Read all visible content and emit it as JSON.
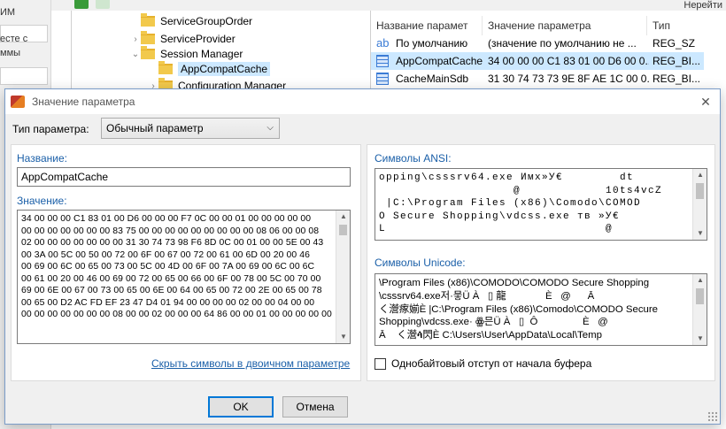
{
  "background": {
    "left_fragments": [
      "ИМ",
      "есте с",
      "ммы"
    ],
    "toolbar_edge_text": "Нерейти",
    "tree": {
      "items": [
        {
          "label": "ServiceGroupOrder",
          "expanded": false,
          "selected": false
        },
        {
          "label": "ServiceProvider",
          "expanded": false,
          "selected": false
        },
        {
          "label": "Session Manager",
          "expanded": true,
          "selected": false
        },
        {
          "label": "AppCompatCache",
          "expanded": false,
          "selected": true
        },
        {
          "label": "Configuration Manager",
          "expanded": false,
          "selected": false
        }
      ]
    },
    "list": {
      "headers": [
        "Название парамет",
        "Значение параметра",
        "Тип"
      ],
      "rows": [
        {
          "icon": "string-value-icon",
          "name": "По умолчанию",
          "value": "(значение по умолчанию не ...",
          "type": "REG_SZ"
        },
        {
          "icon": "binary-value-icon",
          "name": "AppCompatCache",
          "value": "34 00 00 00 C1 83 01 00 D6 00 0...",
          "type": "REG_BI..."
        },
        {
          "icon": "binary-value-icon",
          "name": "CacheMainSdb",
          "value": "31 30 74 73 73 9E 8F AE 1C 00 0...",
          "type": "REG_BI..."
        }
      ]
    }
  },
  "dialog": {
    "title": "Значение параметра",
    "type_label": "Тип параметра:",
    "type_value": "Обычный параметр",
    "name_label": "Название:",
    "name_value": "AppCompatCache",
    "value_label": "Значение:",
    "hex_lines": [
      "34 00 00 00 C1 83 01 00 D6 00 00 00 F7 0C 00 00 01 00 00 00 00 00",
      "00 00 00 00 00 00 00 83 75 00 00 00 00 00 00 00 00 00 08 06 00 00 08",
      "02 00 00 00 00 00 00 00 31 30 74 73 98 F6 8D 0C 00 01 00 00 5E 00 43",
      "00 3A 00 5C 00 50 00 72 00 6F 00 67 00 72 00 61 00 6D 00 20 00 46",
      "00 69 00 6C 00 65 00 73 00 5C 00 4D 00 6F 00 7A 00 69 00 6C 00 6C",
      "00 61 00 20 00 46 00 69 00 72 00 65 00 66 00 6F 00 78 00 5C 00 70 00",
      "69 00 6E 00 67 00 73 00 65 00 6E 00 64 00 65 00 72 00 2E 00 65 00 78",
      "00 65 00 D2 AC FD EF 23 47 D4 01 94 00 00 00 00 02 00 00 04 00 00",
      "00 00 00 00 00 00 00 08 00 00 02 00 00 00 64 86 00 00 01 00 00 00 00 00"
    ],
    "link_text": "Скрыть символы в двоичном параметре",
    "ansi_label": "Символы ANSI:",
    "ansi_lines": [
      "opping\\csssrv64.exe Имх»У€        dt",
      "                   @            10ts4vcZ",
      " |C:\\Program Files (x86)\\Comodo\\COMOD",
      "O Secure Shopping\\vdcss.exe тв »У€",
      "L                               @"
    ],
    "unicode_label": "Символы Unicode:",
    "unicode_lines": [
      "\\Program Files (x86)\\COMODO\\COMODO Secure Shopping",
      "\\csssrv64.exe저·뭏Ü À   ▯ 龍              È   @      Ā",
      "く瀯瘃媊È |C:\\Program Files (x86)\\Comodo\\COMODO Secure",
      "Shopping\\vdcss.exe· ꙮ믄Ü À   ▯  Ô                È   @",
      "Ā    く瀯ꬃ閃È C:\\Users\\User\\AppData\\Local\\Temp"
    ],
    "checkbox_label": "Однобайтовый отступ от начала буфера",
    "ok_label": "OK",
    "cancel_label": "Отмена"
  }
}
